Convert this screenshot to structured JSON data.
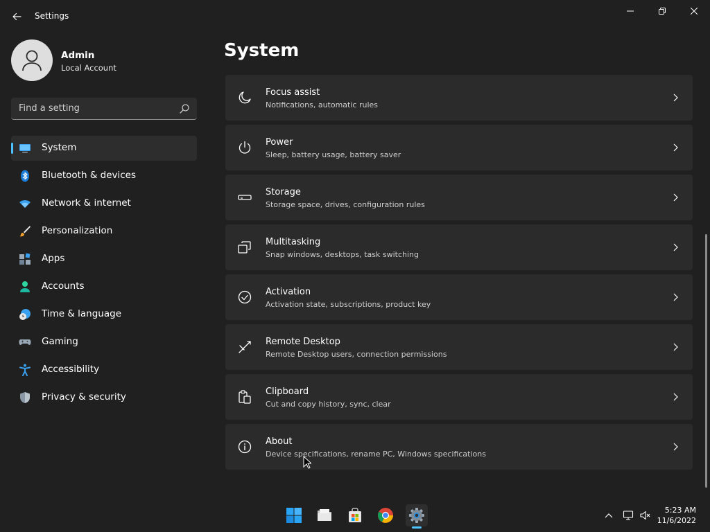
{
  "window": {
    "title": "Settings"
  },
  "profile": {
    "name": "Admin",
    "account_type": "Local Account"
  },
  "search": {
    "placeholder": "Find a setting"
  },
  "nav": {
    "items": [
      {
        "label": "System",
        "icon": "monitor-icon",
        "selected": true
      },
      {
        "label": "Bluetooth & devices",
        "icon": "bluetooth-icon"
      },
      {
        "label": "Network & internet",
        "icon": "wifi-icon"
      },
      {
        "label": "Personalization",
        "icon": "brush-icon"
      },
      {
        "label": "Apps",
        "icon": "apps-icon"
      },
      {
        "label": "Accounts",
        "icon": "person-icon"
      },
      {
        "label": "Time & language",
        "icon": "clock-globe-icon"
      },
      {
        "label": "Gaming",
        "icon": "gamepad-icon"
      },
      {
        "label": "Accessibility",
        "icon": "accessibility-icon"
      },
      {
        "label": "Privacy & security",
        "icon": "shield-icon"
      }
    ]
  },
  "main": {
    "title": "System",
    "cards": [
      {
        "title": "Focus assist",
        "subtitle": "Notifications, automatic rules",
        "icon": "moon-icon"
      },
      {
        "title": "Power",
        "subtitle": "Sleep, battery usage, battery saver",
        "icon": "power-icon"
      },
      {
        "title": "Storage",
        "subtitle": "Storage space, drives, configuration rules",
        "icon": "drive-icon"
      },
      {
        "title": "Multitasking",
        "subtitle": "Snap windows, desktops, task switching",
        "icon": "multitask-icon"
      },
      {
        "title": "Activation",
        "subtitle": "Activation state, subscriptions, product key",
        "icon": "checkmark-circle-icon"
      },
      {
        "title": "Remote Desktop",
        "subtitle": "Remote Desktop users, connection permissions",
        "icon": "remote-desktop-icon"
      },
      {
        "title": "Clipboard",
        "subtitle": "Cut and copy history, sync, clear",
        "icon": "clipboard-icon"
      },
      {
        "title": "About",
        "subtitle": "Device specifications, rename PC, Windows specifications",
        "icon": "info-icon"
      }
    ]
  },
  "taskbar": {
    "apps": [
      "windows-start-icon",
      "file-explorer-icon",
      "store-icon",
      "chrome-icon",
      "settings-gear-icon"
    ],
    "tray": [
      "chevron-up-icon",
      "network-icon",
      "volume-muted-icon"
    ],
    "time": "5:23 AM",
    "date": "11/6/2022"
  },
  "colors": {
    "accent": "#4cc2ff",
    "background": "#202020",
    "card": "#2b2b2b"
  }
}
